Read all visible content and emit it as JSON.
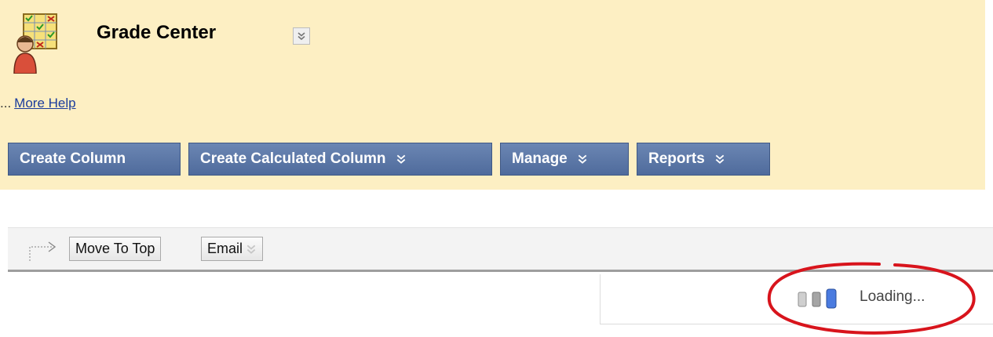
{
  "header": {
    "title": "Grade Center",
    "help_prefix": "...",
    "help_link": "More Help",
    "background": "#fdefc3",
    "icons": {
      "page_icon": "grade-center-icon",
      "title_menu": "double-chevron-down-icon"
    }
  },
  "action_bar": {
    "buttons": [
      {
        "label": "Create Column",
        "menu": false
      },
      {
        "label": "Create Calculated Column",
        "menu": true
      },
      {
        "label": "Manage",
        "menu": true
      },
      {
        "label": "Reports",
        "menu": true
      }
    ],
    "button_color": "#5a76a8"
  },
  "toolbar": {
    "move_to_top": "Move To Top",
    "email": "Email",
    "icons": {
      "arrow": "move-arrow-icon",
      "email_menu": "double-chevron-down-icon"
    }
  },
  "loading": {
    "text": "Loading...",
    "icon": "loading-bars-icon",
    "annotation_color": "#d8141c"
  }
}
